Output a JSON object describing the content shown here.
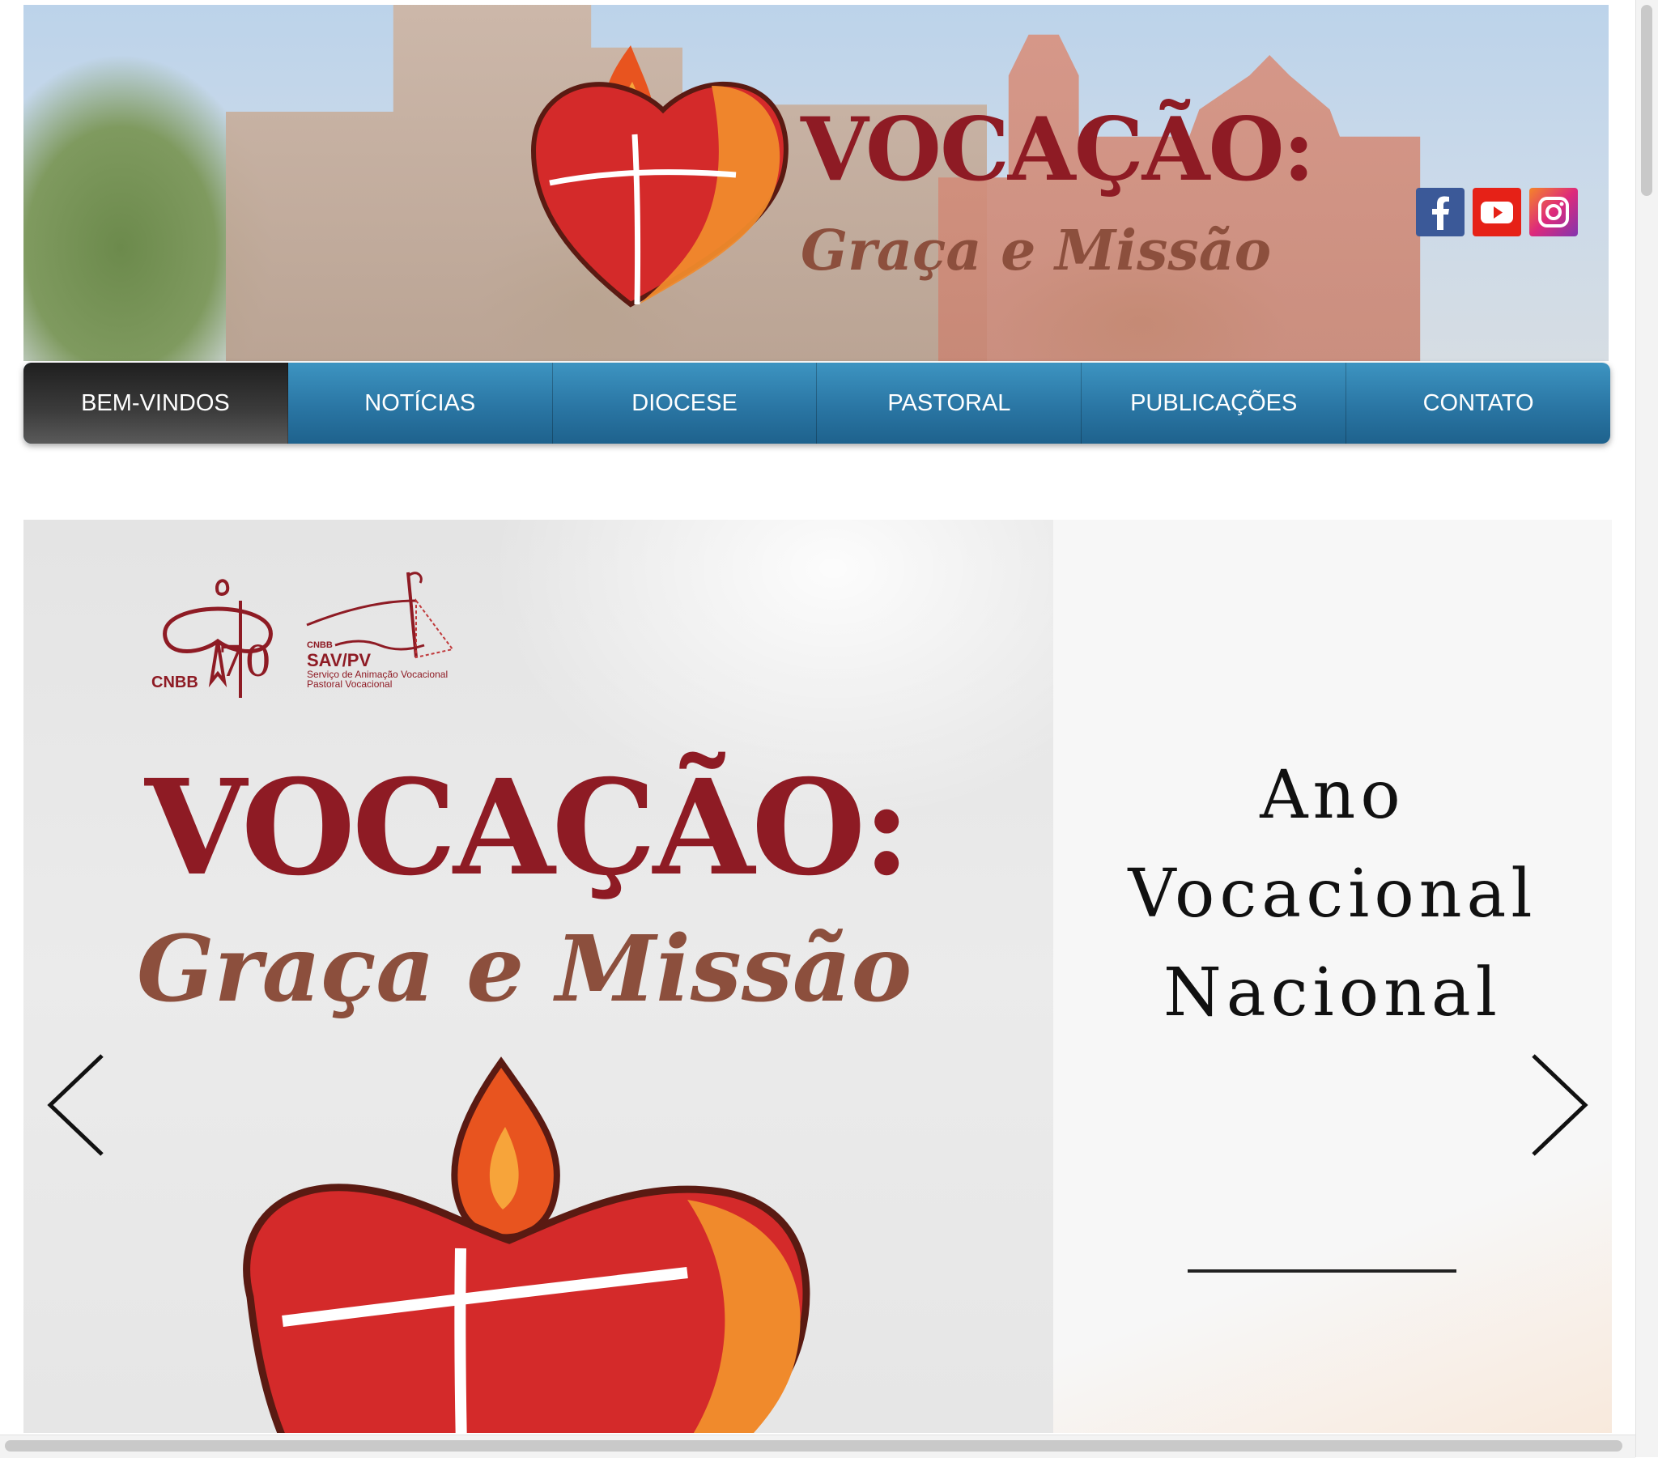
{
  "header": {
    "banner_title": "VOCAÇÃO:",
    "banner_subtitle": "Graça e Missão",
    "social": [
      {
        "name": "facebook-icon",
        "color": "#3b5998"
      },
      {
        "name": "youtube-icon",
        "color": "#e62117"
      },
      {
        "name": "instagram-icon",
        "color": "#dd2a7b"
      }
    ]
  },
  "nav": {
    "items": [
      {
        "label": "BEM-VINDOS",
        "active": true
      },
      {
        "label": "NOTÍCIAS"
      },
      {
        "label": "DIOCESE"
      },
      {
        "label": "PASTORAL"
      },
      {
        "label": "PUBLICAÇÕES"
      },
      {
        "label": "CONTATO"
      }
    ]
  },
  "slide": {
    "image": {
      "cnbb_label": "CNBB",
      "anos_number": "70",
      "sav_top": "CNBB",
      "sav_name": "SAV/PV",
      "sav_line1": "Serviço de Animação Vocacional",
      "sav_line2": "Pastoral Vocacional",
      "title": "VOCAÇÃO:",
      "subtitle": "Graça e Missão"
    },
    "title_lines": [
      "Ano",
      "Vocacional",
      "Nacional"
    ]
  },
  "colors": {
    "brand_red": "#8e1b24",
    "brand_brown": "#8c4f3d",
    "nav_blue": "#2a76a4",
    "nav_active": "#333333"
  }
}
